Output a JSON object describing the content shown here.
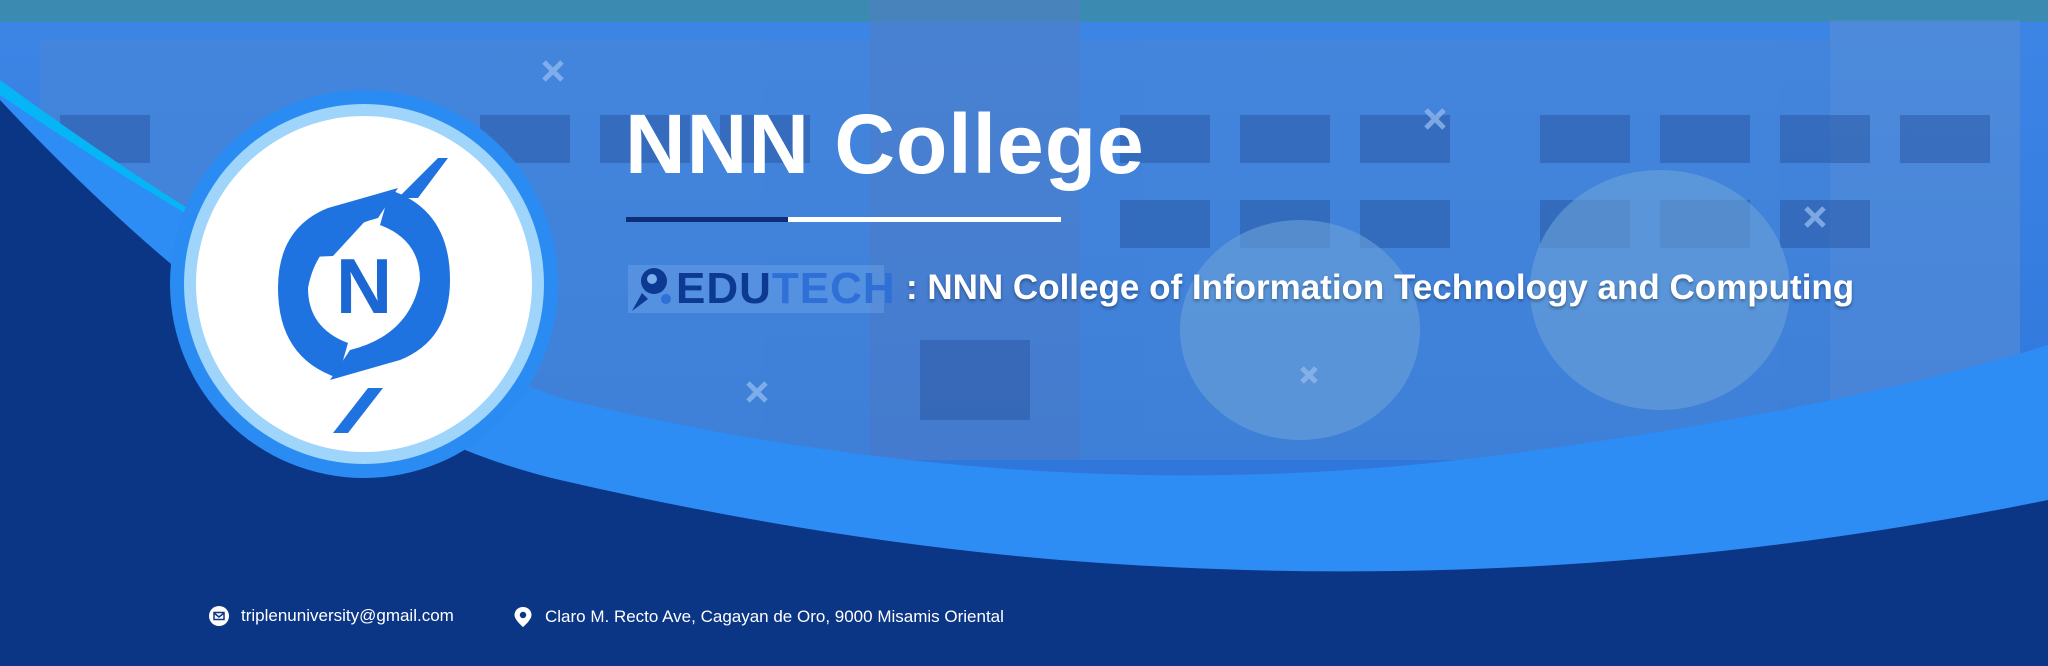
{
  "title": "NNN College",
  "logo_letter": "N",
  "brand": {
    "part1": "EDU",
    "part2": "TECH"
  },
  "subtitle": ": NNN College of Information Technology and Computing",
  "contact": {
    "email": "triplenuniversity@gmail.com",
    "address": "Claro M. Recto Ave, Cagayan de Oro, 9000 Misamis Oriental"
  },
  "icons": [
    "college-logo-icon",
    "edutech-drop-icon",
    "mail-icon",
    "location-pin-icon",
    "cross-decoration-icon"
  ],
  "colors": {
    "navy": "#0b3585",
    "blue": "#2e8cf5",
    "cyan": "#06b5f5",
    "white": "#ffffff"
  }
}
